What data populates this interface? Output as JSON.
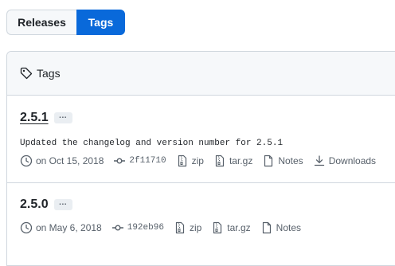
{
  "segmented": {
    "releases_label": "Releases",
    "tags_label": "Tags",
    "active": "Tags"
  },
  "panel": {
    "header_title": "Tags"
  },
  "tags": [
    {
      "name": "2.5.1",
      "more_label": "...",
      "message": "Updated the changelog and version number for 2.5.1",
      "date": "on Oct 15, 2018",
      "sha": "2f11710",
      "zip_label": "zip",
      "targz_label": "tar.gz",
      "notes_label": "Notes",
      "downloads_label": "Downloads"
    },
    {
      "name": "2.5.0",
      "more_label": "...",
      "date": "on May 6, 2018",
      "sha": "192eb96",
      "zip_label": "zip",
      "targz_label": "tar.gz",
      "notes_label": "Notes"
    }
  ],
  "colors": {
    "accent": "#0969da",
    "border": "#d0d7de",
    "muted": "#57606a",
    "header_bg": "#f6f8fa"
  }
}
